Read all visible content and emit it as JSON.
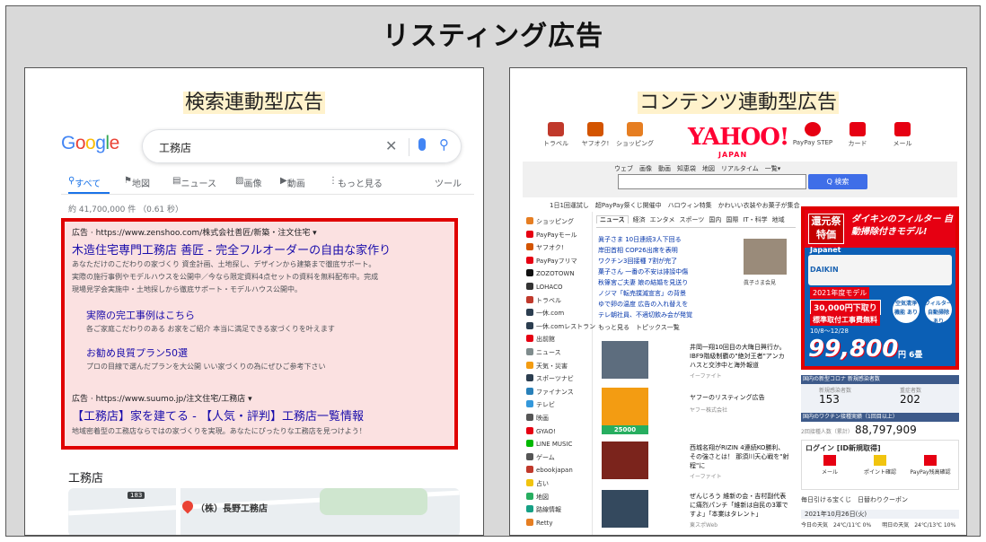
{
  "header": {
    "title": "リスティング広告"
  },
  "left_panel": {
    "title": "検索連動型広告",
    "google": {
      "logo": [
        "G",
        "o",
        "o",
        "g",
        "l",
        "e"
      ],
      "query": "工務店",
      "tabs": [
        "すべて",
        "地図",
        "ニュース",
        "画像",
        "動画",
        "もっと見る",
        "ツール"
      ],
      "stats": "約 41,700,000 件 （0.61 秒）",
      "ad": {
        "head": "広告 · https://www.zenshoo.com/株式会社善匠/新築・注文住宅 ▾",
        "title": "木造住宅専門工務店 善匠 - 完全フルオーダーの自由な家作り",
        "desc": [
          "あなただけのこだわりの家づくり 資金計画、土地探し、デザインから建築まで徹底サポート。",
          "実際の施行事例やモデルハウスを公開中／今なら限定資料4点セットの資料を無料配布中。完成",
          "現場見学会実施中・土地探しから徹底サポート・モデルハウス公開中。"
        ],
        "sitelinks": [
          {
            "title": "実際の完工事例はこちら",
            "desc": "各ご家庭こだわりのある お家をご紹介 本当に満足できる家づくりを叶えます"
          },
          {
            "title": "お勧め良質プラン50選",
            "desc": "プロの目線で選んだプランを大公開 いい家づくりの為にぜひご参考下さい"
          }
        ]
      },
      "ad2": {
        "head": "広告 · https://www.suumo.jp/注文住宅/工務店 ▾",
        "title": "【工務店】家を建てる - 【人気・評判】工務店一覧情報",
        "desc": "地域密着型の工務店ならではの家づくりを実現。あなたにぴったりな工務店を見つけよう！"
      },
      "local": {
        "heading": "工務店",
        "map_label": "（株）長野工務店",
        "road_badge": "183"
      }
    }
  },
  "right_panel": {
    "title": "コンテンツ連動型広告",
    "yahoo": {
      "header_icons": [
        {
          "label": "トラベル",
          "icon": "suitcase-icon",
          "color": "#c0392b"
        },
        {
          "label": "ヤフオク!",
          "icon": "gavel-icon",
          "color": "#d35400"
        },
        {
          "label": "ショッピング",
          "icon": "cart-icon",
          "color": "#e67e22"
        },
        {
          "label": "PayPay STEP",
          "icon": "paypay-icon",
          "color": "#e60012"
        },
        {
          "label": "カード",
          "icon": "card-icon",
          "color": "#e60012"
        },
        {
          "label": "メール",
          "icon": "mail-icon",
          "color": "#e60012"
        }
      ],
      "logo": "YAHOO!",
      "logo_sub": "JAPAN",
      "search_tabs": "ウェブ　画像　動画　知恵袋　地図　リアルタイム　一覧▾",
      "search_button": "Q 検索",
      "ticker": "1日1回運試し　超PayPay祭くじ開催中　ハロウィン特集　かわいい衣装やお菓子が集合",
      "sidebar": [
        {
          "label": "ショッピング",
          "color": "#e67e22"
        },
        {
          "label": "PayPayモール",
          "color": "#e60012"
        },
        {
          "label": "ヤフオク!",
          "color": "#d35400"
        },
        {
          "label": "PayPayフリマ",
          "color": "#e60012"
        },
        {
          "label": "ZOZOTOWN",
          "color": "#111111"
        },
        {
          "label": "LOHACO",
          "color": "#333333"
        },
        {
          "label": "トラベル",
          "color": "#c0392b"
        },
        {
          "label": "一休.com",
          "color": "#2c3e50"
        },
        {
          "label": "一休.comレストラン",
          "color": "#2c3e50"
        },
        {
          "label": "出前館",
          "color": "#e60012"
        },
        {
          "label": "ニュース",
          "color": "#7f8c8d"
        },
        {
          "label": "天気・災害",
          "color": "#f39c12"
        },
        {
          "label": "スポーツナビ",
          "color": "#2c3e50"
        },
        {
          "label": "ファイナンス",
          "color": "#2980b9"
        },
        {
          "label": "テレビ",
          "color": "#3498db"
        },
        {
          "label": "映画",
          "color": "#555555"
        },
        {
          "label": "GYAO!",
          "color": "#e60012"
        },
        {
          "label": "LINE MUSIC",
          "color": "#00b900"
        },
        {
          "label": "ゲーム",
          "color": "#555555"
        },
        {
          "label": "ebookjapan",
          "color": "#c0392b"
        },
        {
          "label": "占い",
          "color": "#f1c40f"
        },
        {
          "label": "地図",
          "color": "#27ae60"
        },
        {
          "label": "路線情報",
          "color": "#16a085"
        },
        {
          "label": "Retty",
          "color": "#e67e22"
        }
      ],
      "news_tabs": [
        "ニュース",
        "経済",
        "エンタメ",
        "スポーツ",
        "国内",
        "国際",
        "IT・科学",
        "地域"
      ],
      "news_lines": [
        "眞子さま 10日連続3人下回る",
        "岸田首相 COP26出席を表明",
        "ワクチン3回接種 7割が完了",
        "菓子さん 一番の不安は誹謗中傷",
        "秋篠宮ご夫妻 娘の結婚を見送り",
        "ノジマ「転売撲滅宣言」の背景",
        "ゆで卵の温度 広告の入れ替えを",
        "テレ朝社員、不適切飲み会が発覚"
      ],
      "news_more": "もっと見る　トピックス一覧",
      "news_photo_caption": "眞子さま会見",
      "feed": [
        {
          "text": "井岡一翔10回目の大晦日興行か。IBF9階級制覇の\"絶対王者\"アンカハスと交渉中と海外報道",
          "meta": "イーファイト",
          "img": "#5d6d7e"
        },
        {
          "text": "ヤフーのリスティング広告",
          "meta": "ヤフー株式会社",
          "img": "#f39c12",
          "badge": "25000"
        },
        {
          "text": "西城名翔がRIZIN 4連続KO勝利、その強さとは！ 那須川天心戦を\"射程\"に",
          "meta": "イーファイト",
          "img": "#7b241c"
        },
        {
          "text": "ぜんじろう 維新の会・吉村副代表に痛烈パンチ「維新は自民の3軍ですよ」「本業はタレント」",
          "meta": "東スポWeb",
          "img": "#34495e"
        }
      ],
      "banner": {
        "tag": "還元祭 特価",
        "headline": "ダイキンのフィルター 自動掃除付きモデル!",
        "brand": "Japanet",
        "brand2": "DAIKIN",
        "model": "2021年度モデル",
        "offer": "30,000円下取り",
        "offer2": "標準取付工事費無料",
        "circle1": "空気清浄 機能 あり",
        "circle2": "フィルター 自動掃除 あり",
        "date": "10/8〜12/28",
        "price": "99,800",
        "yen": "円 6畳"
      },
      "covid": {
        "head": "国内の新型コロナ 新規感染者数",
        "n1": "153",
        "n2": "202",
        "label1": "新規感染者数",
        "label2": "重症者数"
      },
      "vax": {
        "head": "国内のワクチン接種実績（1回目以上）",
        "value": "88,797,909",
        "label": "2回接種人数（累計）"
      },
      "login": {
        "title": "ログイン [ID新規取得]",
        "icons": [
          "メール",
          "ポイント確認",
          "PayPay残高確認"
        ]
      },
      "coupon": "毎日引ける宝くじ　日替わりクーポン",
      "date": "2021年10月26日(火)",
      "weather": "今日の天気　24℃/11℃ 0%　　明日の天気　24℃/13℃ 10%"
    }
  }
}
